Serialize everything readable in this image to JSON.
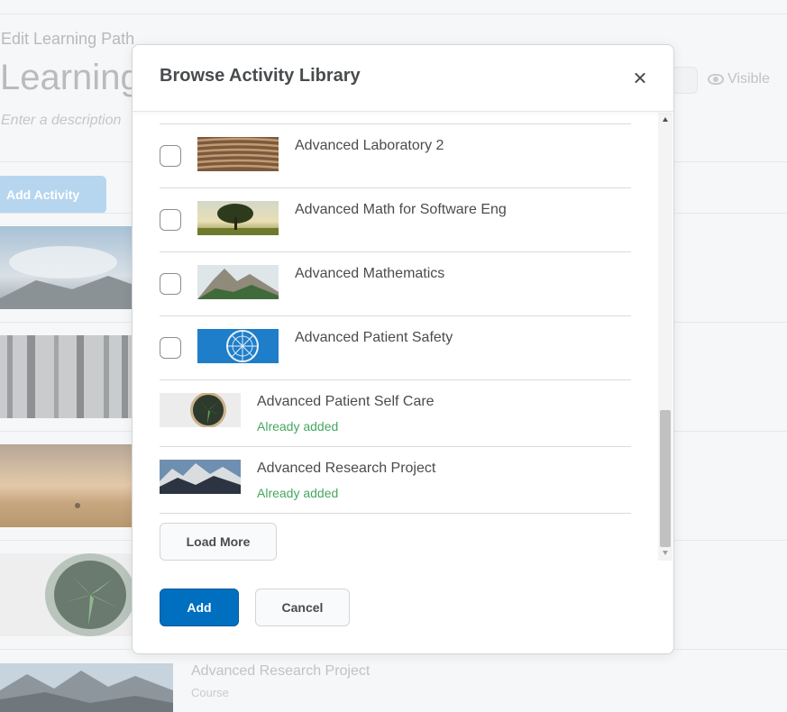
{
  "background": {
    "breadcrumb": "Edit Learning Path",
    "title": "Learning",
    "description_placeholder": "Enter a description",
    "visibility_label": "Visible",
    "add_activity_label": "Add Activity",
    "last_item": {
      "title": "Advanced Research Project",
      "type": "Course"
    }
  },
  "modal": {
    "title": "Browse Activity Library",
    "close_icon": "close-icon",
    "items": [
      {
        "title": "Advanced Laboratory 2",
        "status": ""
      },
      {
        "title": "Advanced Math for Software Eng",
        "status": ""
      },
      {
        "title": "Advanced Mathematics",
        "status": ""
      },
      {
        "title": "Advanced Patient Safety",
        "status": ""
      },
      {
        "title": "Advanced Patient Self Care",
        "status": "Already added"
      },
      {
        "title": "Advanced Research Project",
        "status": "Already added"
      }
    ],
    "load_more_label": "Load More",
    "add_label": "Add",
    "cancel_label": "Cancel"
  },
  "colors": {
    "primary": "#006fbf",
    "already_added": "#46a661",
    "text": "#494c4e"
  }
}
